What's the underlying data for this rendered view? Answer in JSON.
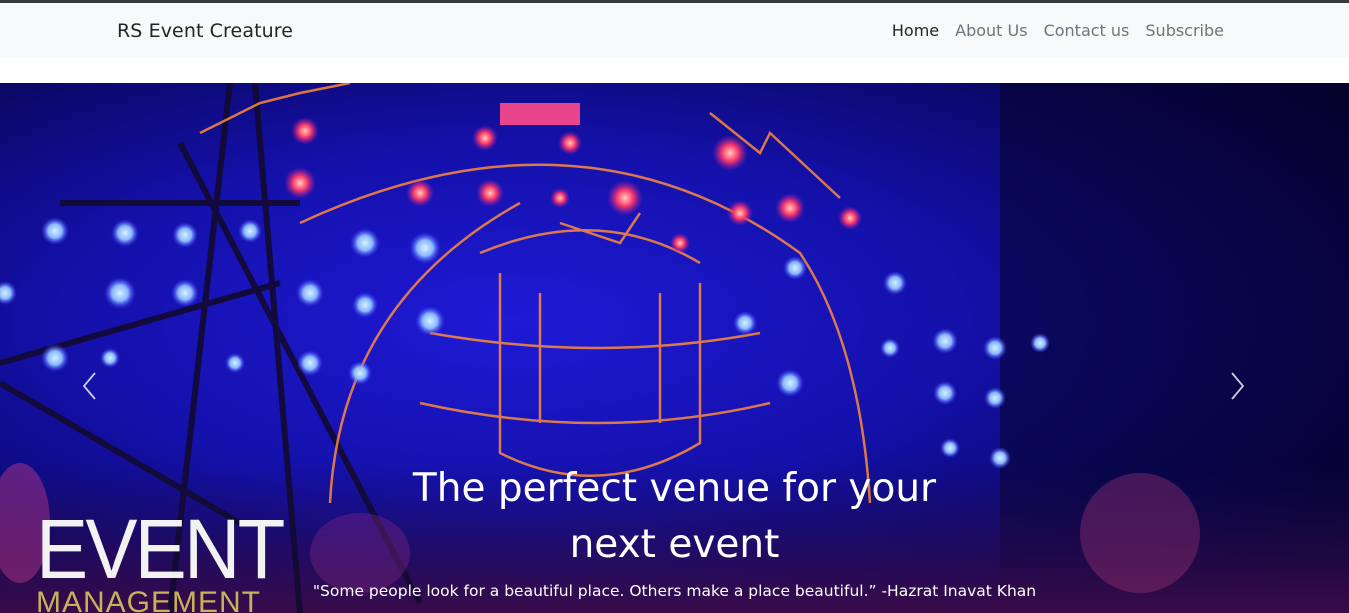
{
  "navbar": {
    "brand": "RS Event Creature",
    "links": [
      {
        "label": "Home",
        "active": true
      },
      {
        "label": "About Us",
        "active": false
      },
      {
        "label": "Contact us",
        "active": false
      },
      {
        "label": "Subscribe",
        "active": false
      }
    ]
  },
  "hero": {
    "title": "The perfect venue for your next event",
    "quote": "\"Some people look for a beautiful place. Others make a place beautiful.” -Hazrat Inavat Khan",
    "logo_word": "EVENT",
    "logo_sub": "MANAGEMENT",
    "prev_icon": "chevron-left-icon",
    "next_icon": "chevron-right-icon"
  },
  "colors": {
    "navbar_bg": "#f8f9fa",
    "brand_text": "#212529",
    "nav_inactive": "#6c757d",
    "hero_base": "#07053a",
    "caption_text": "#ffffff"
  }
}
